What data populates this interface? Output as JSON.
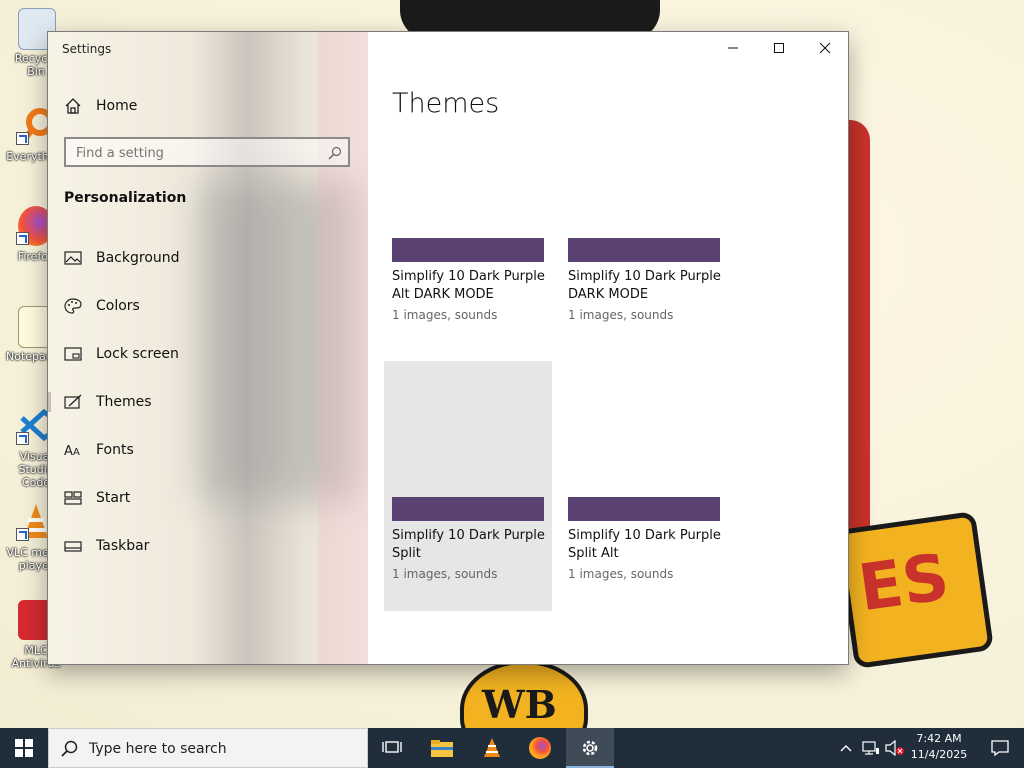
{
  "desktop": {
    "icons": [
      {
        "label": "Recycle Bin"
      },
      {
        "label": "Everything"
      },
      {
        "label": "Firefox"
      },
      {
        "label": "Notepad++"
      },
      {
        "label": "Visual Studio Code"
      },
      {
        "label": "VLC media player"
      },
      {
        "label": "MLC Antivirus"
      }
    ],
    "wallpaper_text": "ES",
    "wallpaper_wb": "WB"
  },
  "window": {
    "title": "Settings",
    "home_label": "Home",
    "search_placeholder": "Find a setting",
    "section_title": "Personalization",
    "nav": [
      {
        "label": "Background",
        "icon": "picture-icon"
      },
      {
        "label": "Colors",
        "icon": "palette-icon"
      },
      {
        "label": "Lock screen",
        "icon": "lock-screen-icon"
      },
      {
        "label": "Themes",
        "icon": "brush-icon"
      },
      {
        "label": "Fonts",
        "icon": "font-icon"
      },
      {
        "label": "Start",
        "icon": "start-grid-icon"
      },
      {
        "label": "Taskbar",
        "icon": "taskbar-icon"
      }
    ],
    "page_title": "Themes",
    "themes": [
      {
        "name": "Simplify 10 Dark Purple Alt DARK MODE",
        "sub": "1 images, sounds"
      },
      {
        "name": "Simplify 10 Dark Purple DARK MODE",
        "sub": "1 images, sounds"
      },
      {
        "name": "Simplify 10 Dark Purple Split",
        "sub": "1 images, sounds"
      },
      {
        "name": "Simplify 10 Dark Purple Split Alt",
        "sub": "1 images, sounds"
      }
    ],
    "theme_color": "#5a4372"
  },
  "taskbar": {
    "search_placeholder": "Type here to search",
    "time": "7:42 AM",
    "date": "11/4/2025"
  }
}
